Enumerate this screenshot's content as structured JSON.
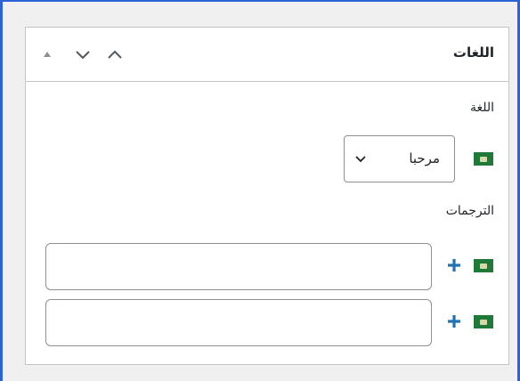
{
  "panel": {
    "title": "اللغات",
    "controls": {
      "move_up_icon": "triangle-up-icon",
      "collapse_icon": "chevron-down-icon",
      "expand_icon": "chevron-up-icon"
    }
  },
  "language_section": {
    "label": "اللغة",
    "selected_value": "مرحبا",
    "flag_icon": "saudi-flag-icon"
  },
  "translations_section": {
    "label": "الترجمات",
    "rows": [
      {
        "value": "",
        "placeholder": "",
        "add_icon": "plus-icon"
      },
      {
        "value": "",
        "placeholder": "",
        "add_icon": "plus-icon"
      }
    ]
  },
  "colors": {
    "frame_border": "#2c62d8",
    "accent": "#2271b1",
    "flag_green": "#1f7a3a"
  }
}
